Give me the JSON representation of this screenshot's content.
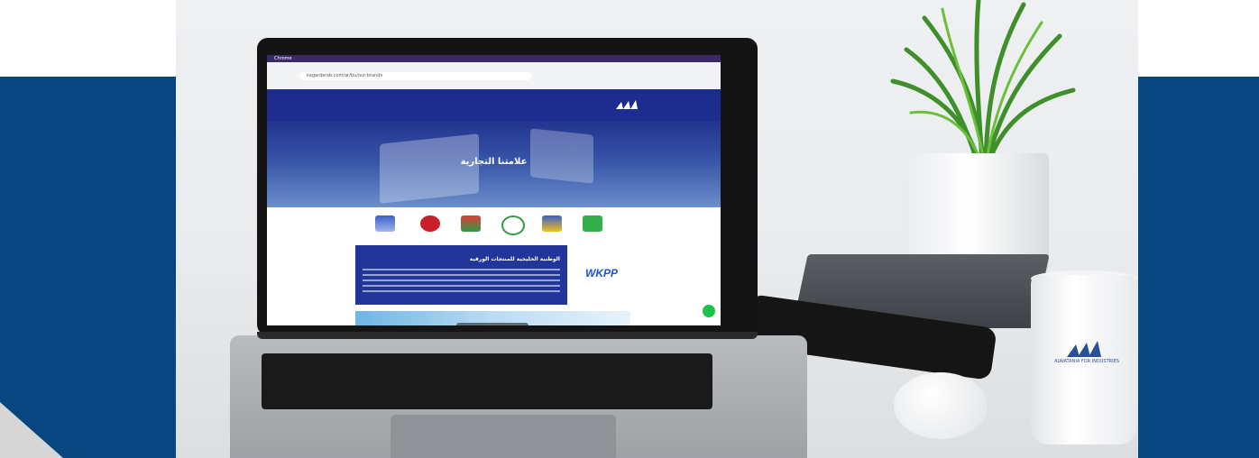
{
  "screen": {
    "menubar_app": "Chrome",
    "url": "kagardersb.com/ar/bu/our-brands",
    "hero_title": "علامتنا التجارية",
    "brand_card": {
      "heading": "الوطنية الخليجية للمنتجات الورقية",
      "logo_text": "WKPP"
    }
  },
  "mug": {
    "brand_text": "ALWATANIA FOR INDUSTRIES"
  },
  "colors": {
    "band_blue": "#08467f",
    "site_blue": "#223699",
    "chat_green": "#1ec24b"
  }
}
